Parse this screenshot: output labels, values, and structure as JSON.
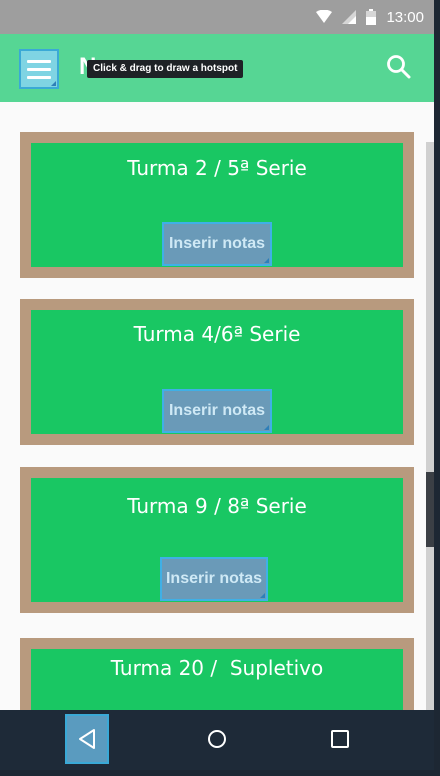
{
  "status_bar": {
    "time": "13:00",
    "icons": [
      "wifi-icon",
      "signal-icon",
      "battery-icon"
    ]
  },
  "header": {
    "menu_icon": "hamburger-menu-icon",
    "title_visible": "N",
    "tooltip": "Click & drag to draw a hotspot",
    "search_icon": "search-icon"
  },
  "cards": [
    {
      "title": "Turma 2 / 5ª Serie",
      "button_label": "Inserir notas"
    },
    {
      "title": "Turma 4/6ª Serie",
      "button_label": "Inserir notas"
    },
    {
      "title": "Turma 9 / 8ª Serie",
      "button_label": "Inserir notas"
    },
    {
      "title": "Turma 20 /  Supletivo",
      "button_label": ""
    }
  ],
  "nav_bar": {
    "icons": [
      "back-icon",
      "home-icon",
      "recents-icon"
    ]
  },
  "colors": {
    "header": "#56d694",
    "card_border": "#b89a7e",
    "card_fill": "#19c763",
    "button_fill": "#6a9ab8",
    "nav_bar": "#1e2a38"
  }
}
